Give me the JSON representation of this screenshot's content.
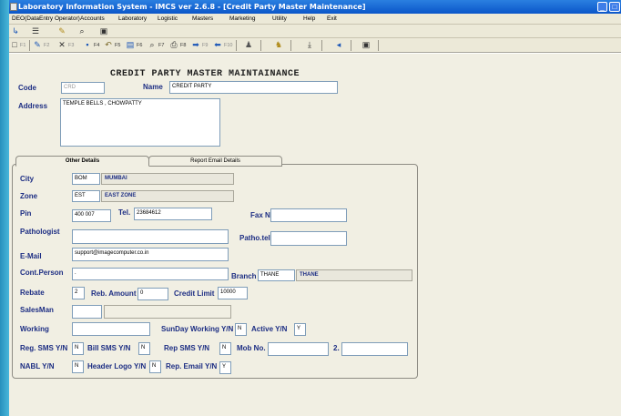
{
  "window": {
    "title": "Laboratory Information System - IMCS ver 2.6.8 - [Credit Party Master Maintenance]",
    "minimize_label": "_",
    "restore_label": "□",
    "close_label": "×"
  },
  "menu": [
    "DEO(DataEntry Operator)",
    "Accounts",
    "Laboratory",
    "Logistic",
    "Masters",
    "Marketing",
    "Utility",
    "Help",
    "Exit"
  ],
  "toolbar_top": [
    "export-icon",
    "list-icon",
    "note-icon",
    "binoculars-icon",
    "window-icon"
  ],
  "toolbar_fkeys": [
    {
      "icon": "new-icon",
      "label": "F1"
    },
    {
      "icon": "edit-icon",
      "label": "F2"
    },
    {
      "icon": "delete-icon",
      "label": "F3"
    },
    {
      "icon": "save-icon",
      "label": "F4"
    },
    {
      "icon": "undo-icon",
      "label": "F5"
    },
    {
      "icon": "print-preview-icon",
      "label": "F6"
    },
    {
      "icon": "find-icon",
      "label": "F7"
    },
    {
      "icon": "print-icon",
      "label": "F8"
    },
    {
      "icon": "next-icon",
      "label": "F9"
    },
    {
      "icon": "prev-icon",
      "label": "F10"
    },
    {
      "icon": "user-icon",
      "label": ""
    },
    {
      "icon": "lock-icon",
      "label": ""
    },
    {
      "icon": "download-icon",
      "label": ""
    },
    {
      "icon": "back-icon",
      "label": ""
    },
    {
      "icon": "monitor-icon",
      "label": ""
    }
  ],
  "form": {
    "heading": "CREDIT PARTY MASTER MAINTAINANCE",
    "code_label": "Code",
    "code_value": "CRD",
    "name_label": "Name",
    "name_value": "CREDIT PARTY",
    "address_label": "Address",
    "address_value": "TEMPLE BELLS , CHOWPATTY"
  },
  "tabs": {
    "other_details": "Other Details",
    "report_email": "Report Email Details"
  },
  "details": {
    "city_label": "City",
    "city_code": "BOM",
    "city_name": "MUMBAI",
    "zone_label": "Zone",
    "zone_code": "EST",
    "zone_name": "EAST ZONE",
    "pin_label": "Pin",
    "pin_value": "400 007",
    "tel_label": "Tel.",
    "tel_value": "23684612",
    "fax_label": "Fax No.",
    "fax_value": "",
    "pathologist_label": "Pathologist",
    "pathologist_value": "",
    "pathotel_label": "Patho.tel",
    "pathotel_value": "",
    "email_label": "E-Mail",
    "email_value": "support@imagecomputer.co.in",
    "contperson_label": "Cont.Person",
    "contperson_value": ".",
    "branch_label": "Branch",
    "branch_code": "THANE",
    "branch_name": "THANE",
    "rebate_label": "Rebate",
    "rebate_value": "2",
    "rebamount_label": "Reb. Amount",
    "rebamount_value": "0",
    "creditlimit_label": "Credit Limit",
    "creditlimit_value": "10000",
    "salesman_label": "SalesMan",
    "working_label": "Working",
    "sundayworking_label": "SunDay Working Y/N",
    "sundayworking_value": "N",
    "active_label": "Active Y/N",
    "active_value": "Y",
    "regsms_label": "Reg. SMS Y/N",
    "regsms_value": "N",
    "billsms_label": "Bill SMS Y/N",
    "billsms_value": "N",
    "repsms_label": "Rep SMS Y/N",
    "repsms_value": "N",
    "mob1_label": "Mob No. 1",
    "mob2_label": "2.",
    "nabl_label": "NABL Y/N",
    "nabl_value": "N",
    "headerlogo_label": "Header Logo Y/N",
    "headerlogo_value": "N",
    "repemail_label": "Rep. Email Y/N",
    "repemail_value": "Y"
  }
}
